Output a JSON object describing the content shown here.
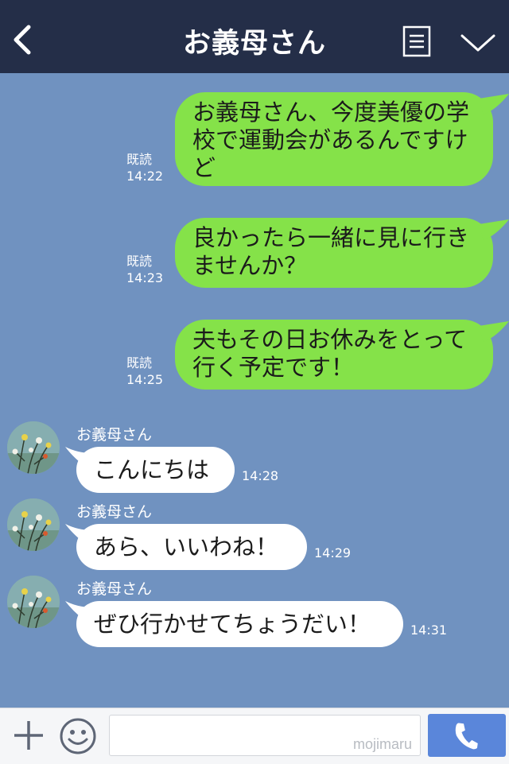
{
  "header": {
    "title": "お義母さん"
  },
  "messages_sent": [
    {
      "text": "お義母さん、今度美優の学校で運動会があるんですけど",
      "read_label": "既読",
      "time": "14:22"
    },
    {
      "text": "良かったら一緒に見に行きませんか？",
      "read_label": "既読",
      "time": "14:23"
    },
    {
      "text": "夫もその日お休みをとって行く予定です！",
      "read_label": "既読",
      "time": "14:25"
    }
  ],
  "messages_received": [
    {
      "sender": "お義母さん",
      "text": "こんにちは",
      "time": "14:28"
    },
    {
      "sender": "お義母さん",
      "text": "あら、いいわね！",
      "time": "14:29"
    },
    {
      "sender": "お義母さん",
      "text": "ぜひ行かせてちょうだい！",
      "time": "14:31"
    }
  ],
  "input": {
    "watermark": "mojimaru"
  },
  "icons": {
    "back": "chevron-left-icon",
    "menu": "document-menu-icon",
    "collapse": "chevron-down-icon",
    "plus": "plus-icon",
    "emoji": "smile-icon",
    "call": "phone-icon"
  },
  "colors": {
    "header_bg": "#242e48",
    "chat_bg": "#7092c0",
    "sent_bubble": "#85e249",
    "received_bubble": "#ffffff",
    "call_button": "#5a86da"
  }
}
